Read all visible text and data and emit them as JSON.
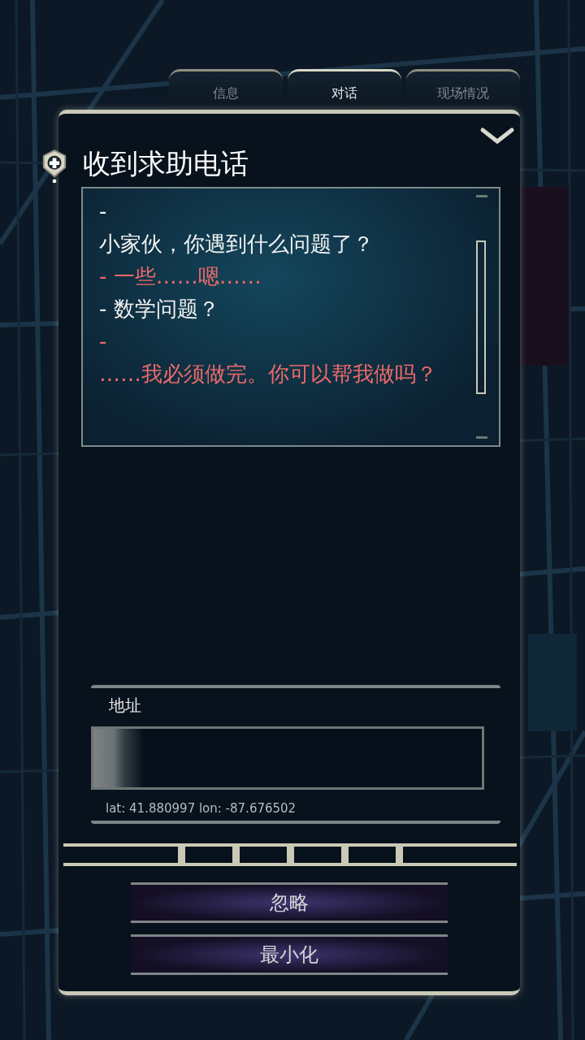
{
  "tabs": [
    {
      "label": "信息",
      "selected": false
    },
    {
      "label": "对话",
      "selected": true
    },
    {
      "label": "现场情况",
      "selected": false
    }
  ],
  "title": "收到求助电话",
  "dialogue": [
    {
      "kind": "dispatcher",
      "text": "-"
    },
    {
      "kind": "dispatcher",
      "text": "小家伙，你遇到什么问题了？"
    },
    {
      "kind": "caller",
      "text": "- 一些……嗯……"
    },
    {
      "kind": "dispatcher",
      "text": "- 数学问题？"
    },
    {
      "kind": "caller",
      "text": "-"
    },
    {
      "kind": "caller",
      "text": "……我必须做完。你可以帮我做吗？"
    }
  ],
  "address": {
    "label": "地址",
    "level": 0.13,
    "coordinates": "lat: 41.880997 lon: -87.676502"
  },
  "buttons": [
    "忽略",
    "最小化"
  ]
}
